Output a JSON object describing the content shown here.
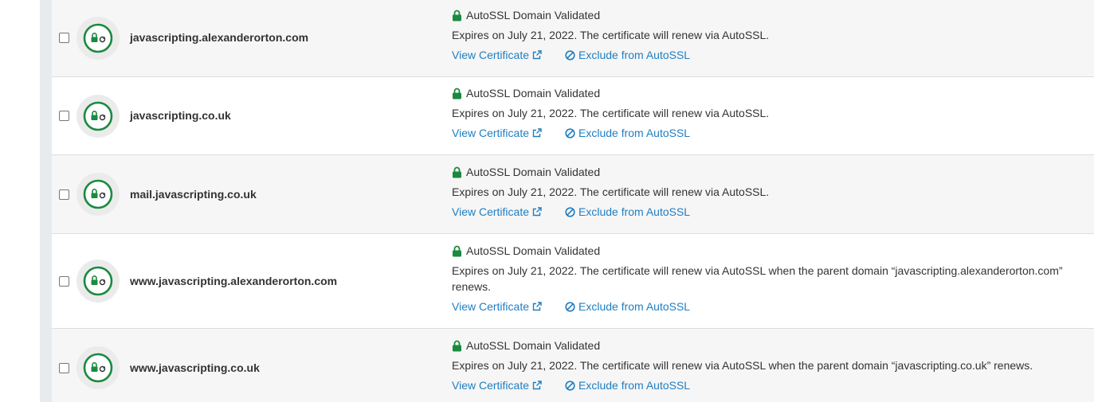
{
  "colors": {
    "link": "#1f7ec2",
    "success_green": "#1a8a3f",
    "row_alt": "#f6f6f6",
    "gutter": "#e8ebee"
  },
  "rows": [
    {
      "domain": "javascripting.alexanderorton.com",
      "status": "AutoSSL Domain Validated",
      "expires": "Expires on July 21, 2022. The certificate will renew via AutoSSL.",
      "view_label": "View Certificate",
      "exclude_label": "Exclude from AutoSSL"
    },
    {
      "domain": "javascripting.co.uk",
      "status": "AutoSSL Domain Validated",
      "expires": "Expires on July 21, 2022. The certificate will renew via AutoSSL.",
      "view_label": "View Certificate",
      "exclude_label": "Exclude from AutoSSL"
    },
    {
      "domain": "mail.javascripting.co.uk",
      "status": "AutoSSL Domain Validated",
      "expires": "Expires on July 21, 2022. The certificate will renew via AutoSSL.",
      "view_label": "View Certificate",
      "exclude_label": "Exclude from AutoSSL"
    },
    {
      "domain": "www.javascripting.alexanderorton.com",
      "status": "AutoSSL Domain Validated",
      "expires": "Expires on July 21, 2022. The certificate will renew via AutoSSL when the parent domain “javascripting.alexanderorton.com” renews.",
      "view_label": "View Certificate",
      "exclude_label": "Exclude from AutoSSL"
    },
    {
      "domain": "www.javascripting.co.uk",
      "status": "AutoSSL Domain Validated",
      "expires": "Expires on July 21, 2022. The certificate will renew via AutoSSL when the parent domain “javascripting.co.uk” renews.",
      "view_label": "View Certificate",
      "exclude_label": "Exclude from AutoSSL"
    }
  ]
}
